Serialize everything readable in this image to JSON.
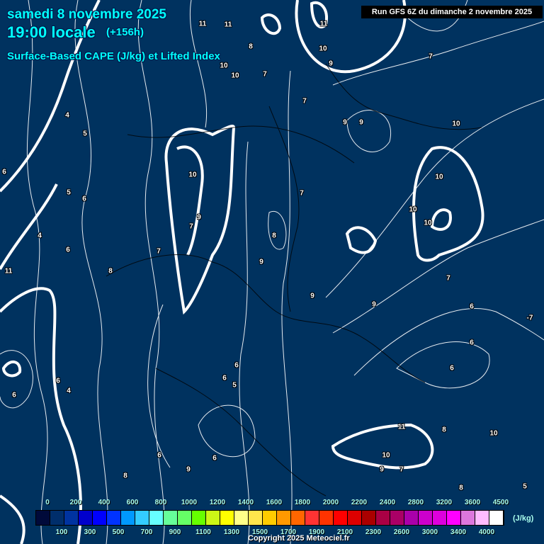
{
  "header": {
    "date": "samedi 8 novembre 2025",
    "time": "19:00 locale",
    "lead": "(+156h)",
    "parameter": "Surface-Based CAPE (J/kg) et Lifted Index",
    "run": "Run GFS 6Z du dimanche 2 novembre 2025"
  },
  "contour_labels": [
    "11",
    "11",
    "11",
    "8",
    "10",
    "10",
    "7",
    "10",
    "9",
    "7",
    "7",
    "9",
    "9",
    "10",
    "10",
    "10",
    "10",
    "4",
    "5",
    "6",
    "5",
    "6",
    "4",
    "6",
    "11",
    "10",
    "9",
    "7",
    "7",
    "8",
    "9",
    "7",
    "8",
    "9",
    "9",
    "7",
    "6",
    "6",
    "-7",
    "6",
    "6",
    "6",
    "5",
    "6",
    "4",
    "6",
    "6",
    "6",
    "9",
    "8",
    "8",
    "10",
    "11",
    "10",
    "9",
    "7",
    "8",
    "5"
  ],
  "legend": {
    "colors": [
      "#000a3a",
      "#002e6b",
      "#0033a0",
      "#0000cc",
      "#0000ff",
      "#0033ff",
      "#0099ff",
      "#33ccff",
      "#66ffff",
      "#66ff99",
      "#66ff66",
      "#66ff00",
      "#ccf716",
      "#ffff00",
      "#ffff88",
      "#ffe64c",
      "#ffcc00",
      "#ff9900",
      "#ff6600",
      "#ff3333",
      "#ff3300",
      "#ff0000",
      "#dd0000",
      "#aa0000",
      "#aa0044",
      "#aa0066",
      "#aa00aa",
      "#cc00cc",
      "#dd00dd",
      "#ff00ff",
      "#dd77dd",
      "#ffbbff",
      "#ffffff"
    ],
    "top_labels": [
      "0",
      "200",
      "400",
      "600",
      "800",
      "1000",
      "1200",
      "1400",
      "1600",
      "1800",
      "2000",
      "2200",
      "2400",
      "2800",
      "3200",
      "3600",
      "4500"
    ],
    "bottom_labels": [
      "100",
      "300",
      "500",
      "700",
      "900",
      "1100",
      "1300",
      "1500",
      "1700",
      "1900",
      "2100",
      "2300",
      "2600",
      "3000",
      "3400",
      "4000"
    ],
    "unit": "(J/kg)"
  },
  "copyright": "Copyright 2025 Meteociel.fr"
}
